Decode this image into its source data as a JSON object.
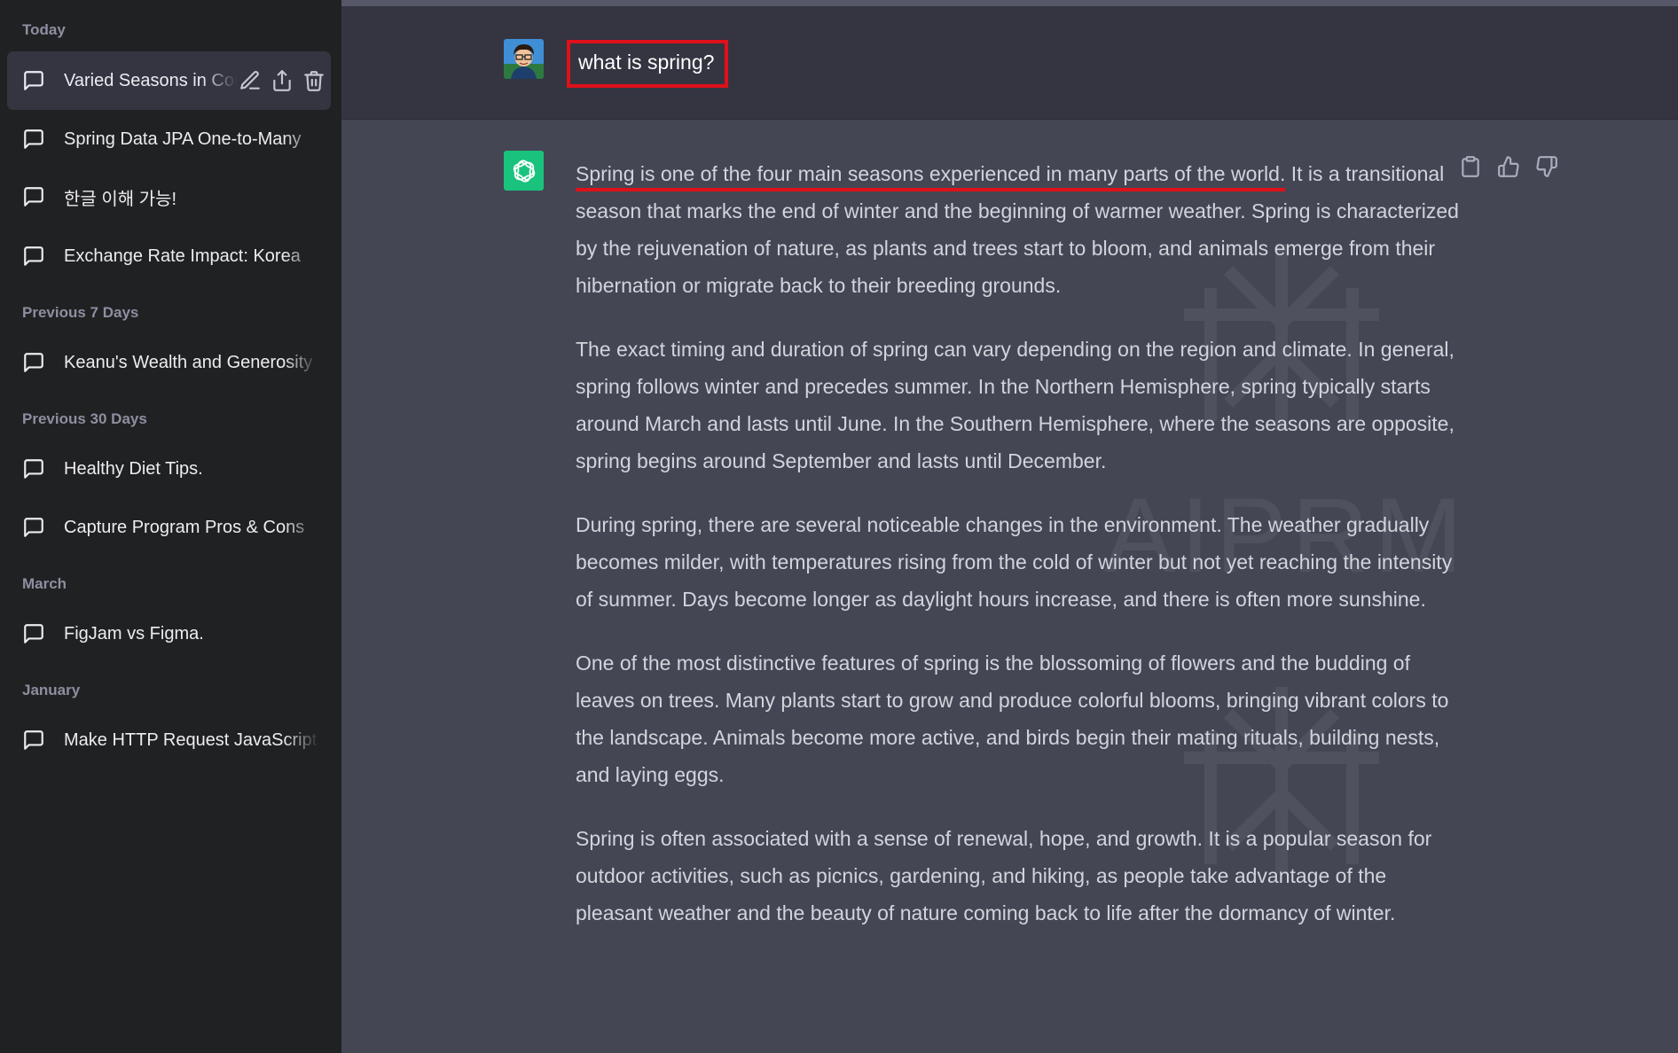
{
  "sidebar": {
    "sections": [
      {
        "label": "Today",
        "items": [
          {
            "label": "Varied Seasons in Countries",
            "active": true
          },
          {
            "label": "Spring Data JPA One-to-Many"
          },
          {
            "label": "한글 이해 가능!"
          },
          {
            "label": "Exchange Rate Impact: Korea"
          }
        ]
      },
      {
        "label": "Previous 7 Days",
        "items": [
          {
            "label": "Keanu's Wealth and Generosity"
          }
        ]
      },
      {
        "label": "Previous 30 Days",
        "items": [
          {
            "label": "Healthy Diet Tips."
          },
          {
            "label": "Capture Program Pros & Cons"
          }
        ]
      },
      {
        "label": "March",
        "items": [
          {
            "label": "FigJam vs Figma."
          }
        ]
      },
      {
        "label": "January",
        "items": [
          {
            "label": "Make HTTP Request JavaScript"
          }
        ]
      }
    ],
    "item_icon": "chat-bubble-icon",
    "active_actions": [
      "edit-icon",
      "share-icon",
      "trash-icon"
    ]
  },
  "conversation": {
    "user_message": "what is spring?",
    "assistant": {
      "highlighted_sentence": "Spring is one of the four main seasons experienced in many parts of the world.",
      "paragraph_1_rest": " It is a transitional season that marks the end of winter and the beginning of warmer weather. Spring is characterized by the rejuvenation of nature, as plants and trees start to bloom, and animals emerge from their hibernation or migrate back to their breeding grounds.",
      "paragraphs": [
        "The exact timing and duration of spring can vary depending on the region and climate. In general, spring follows winter and precedes summer. In the Northern Hemisphere, spring typically starts around March and lasts until June. In the Southern Hemisphere, where the seasons are opposite, spring begins around September and lasts until December.",
        "During spring, there are several noticeable changes in the environment. The weather gradually becomes milder, with temperatures rising from the cold of winter but not yet reaching the intensity of summer. Days become longer as daylight hours increase, and there is often more sunshine.",
        "One of the most distinctive features of spring is the blossoming of flowers and the budding of leaves on trees. Many plants start to grow and produce colorful blooms, bringing vibrant colors to the landscape. Animals become more active, and birds begin their mating rituals, building nests, and laying eggs.",
        "Spring is often associated with a sense of renewal, hope, and growth. It is a popular season for outdoor activities, such as picnics, gardening, and hiking, as people take advantage of the pleasant weather and the beauty of nature coming back to life after the dormancy of winter."
      ]
    },
    "message_actions": [
      "copy-icon",
      "thumbs-up-icon",
      "thumbs-down-icon"
    ],
    "watermark_text": "AIPRM"
  },
  "colors": {
    "sidebar_bg": "#202123",
    "main_bg": "#444654",
    "user_row_bg": "#343541",
    "accent_green": "#19c37d",
    "annotation_red": "#e0101a"
  }
}
